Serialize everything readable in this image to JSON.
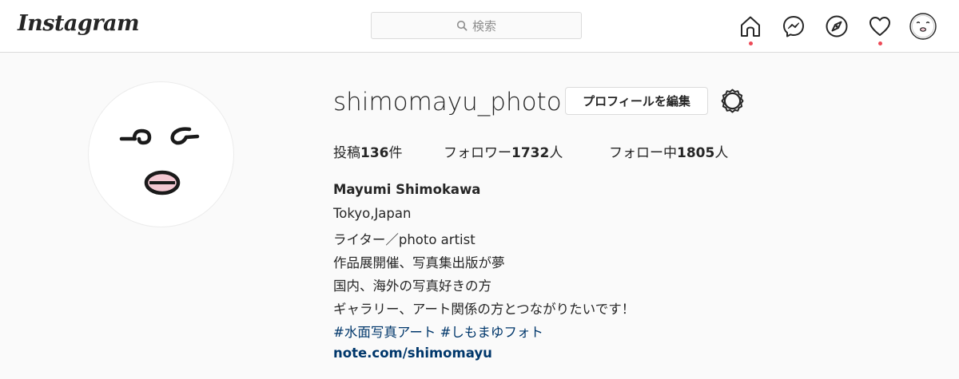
{
  "header": {
    "logo": "Instagram",
    "search_placeholder": "検索",
    "icons": [
      "home-icon",
      "messenger-icon",
      "explore-icon",
      "activity-heart-icon",
      "profile-avatar-icon"
    ],
    "notification_color": "#ed4956"
  },
  "profile": {
    "username": "shimomayu_photo",
    "edit_button": "プロフィールを編集",
    "stats": {
      "posts_label": "投稿",
      "posts_count": "136",
      "posts_unit": "件",
      "followers_label": "フォロワー",
      "followers_count": "1732",
      "followers_unit": "人",
      "following_label": "フォロー中",
      "following_count": "1805",
      "following_unit": "人"
    },
    "full_name": "Mayumi Shimokawa",
    "bio_lines": [
      "Tokyo,Japan",
      "ライター／photo artist",
      "作品展開催、写真集出版が夢",
      "国内、海外の写真好きの方",
      "ギャラリー、アート関係の方とつながりたいです！"
    ],
    "hashtags": "#水面写真アート #しもまゆフォト",
    "website": "note.com/shimomayu"
  }
}
